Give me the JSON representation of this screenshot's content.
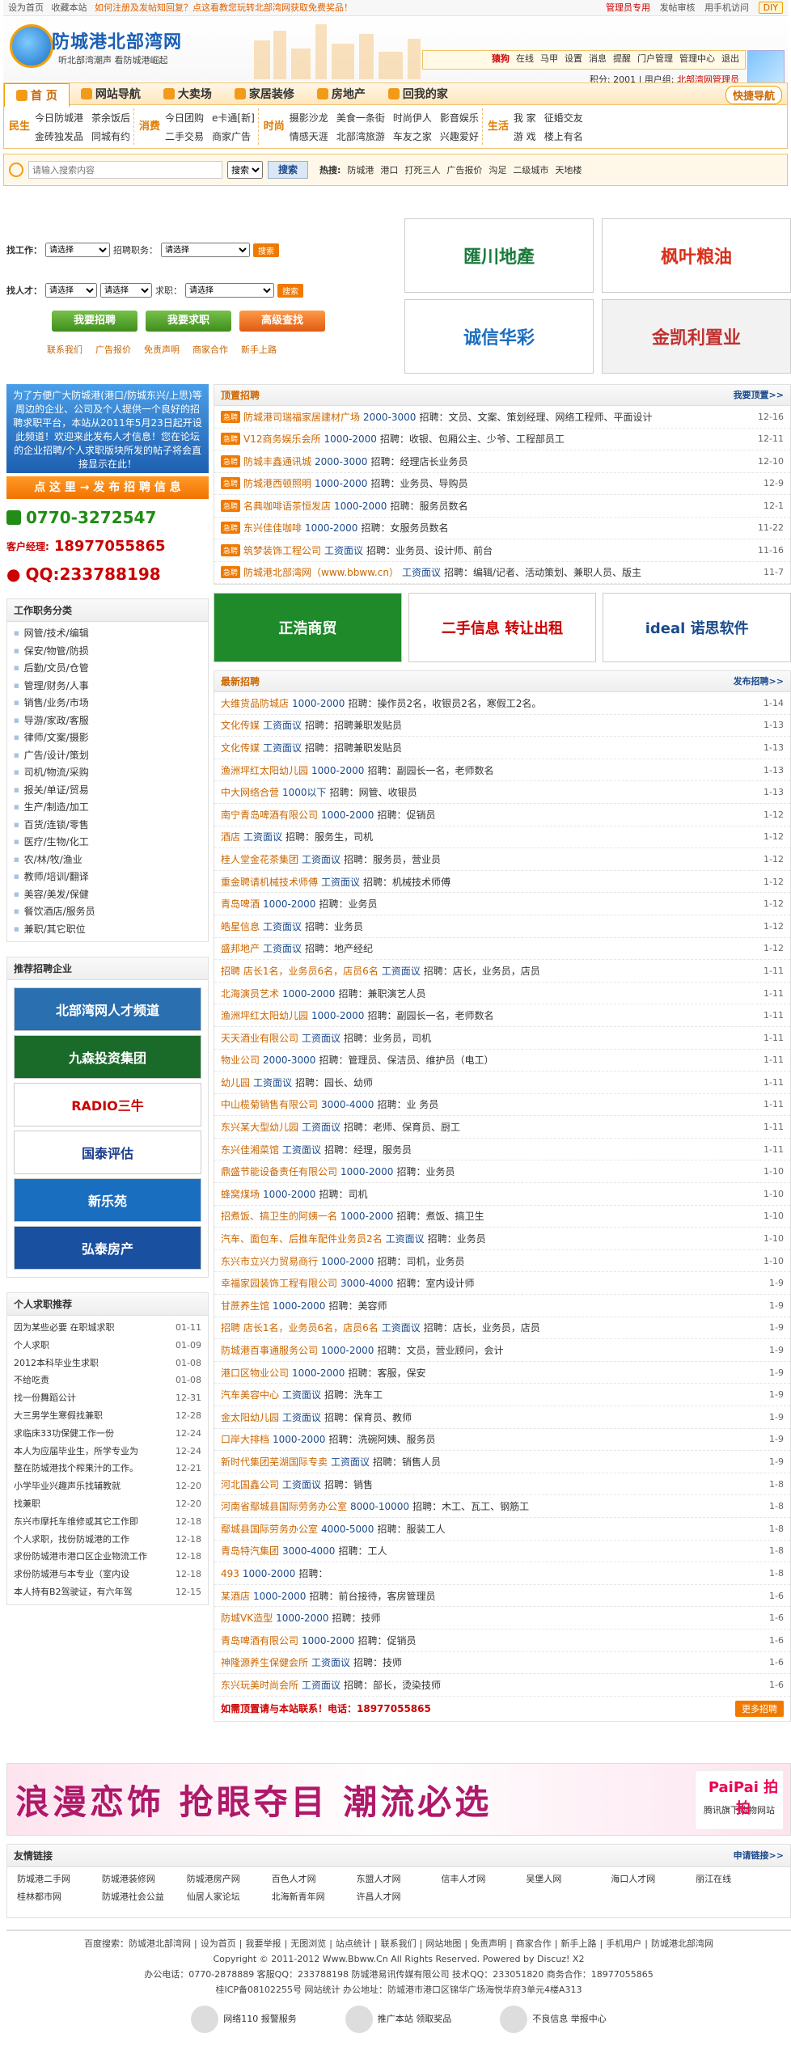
{
  "topbar": {
    "left": [
      "设为首页",
      "收藏本站"
    ],
    "notice": "如何注册及发帖知回复？点这看教您玩转北部湾网获取免费奖品！",
    "right": [
      "管理员专用",
      "发帖审核",
      "用手机访问"
    ],
    "diy": "DIY"
  },
  "logo": {
    "title": "防城港北部湾网",
    "slogan": "听北部湾潮声 看防城港崛起"
  },
  "user": {
    "name": "猿狗",
    "status": "在线",
    "items": [
      "马甲",
      "设置",
      "消息",
      "提醒",
      "门户管理",
      "管理中心",
      "退出"
    ],
    "points": "积分: 2001",
    "group_label": "用户组:",
    "group": "北部湾网管理员"
  },
  "nav": {
    "items": [
      "首 页",
      "网站导航",
      "大卖场",
      "家居装修",
      "房地产",
      "回我的家"
    ],
    "quick": "快捷导航"
  },
  "channels": [
    {
      "big": "民生",
      "links": [
        "今日防城港",
        "茶余饭后",
        "金砖独发品",
        "同城有约"
      ]
    },
    {
      "big": "消费",
      "links": [
        "今日团购",
        "e卡通[新]",
        "二手交易",
        "商家广告"
      ]
    },
    {
      "big": "时尚",
      "links": [
        "摄影沙龙",
        "美食一条街",
        "时尚伊人",
        "影音娱乐",
        "情感天涯",
        "北部湾旅游",
        "车友之家",
        "兴趣爱好"
      ]
    },
    {
      "big": "生活",
      "links": [
        "我 家",
        "征婚交友",
        "游 戏",
        "楼上有名"
      ]
    }
  ],
  "search": {
    "placeholder": "请输入搜索内容",
    "type": "搜索",
    "button": "搜索",
    "hot_label": "热搜:",
    "hot": [
      "防城港",
      "港口",
      "打死三人",
      "广告报价",
      "沟足",
      "二级城市",
      "天地楼"
    ]
  },
  "jobsearch": {
    "find_job": "找工作：",
    "pick": "请选择",
    "position": "招聘职务：",
    "go": "搜索",
    "find_talent": "找人才：",
    "seek": "求职：",
    "buttons": [
      "我要招聘",
      "我要求职",
      "高级查找"
    ],
    "links": [
      "联系我们",
      "广告报价",
      "免责声明",
      "商家合作",
      "新手上路"
    ]
  },
  "ads_tr": [
    "匯川地產",
    "枫叶粮油",
    "诚信华彩",
    "金凯利置业"
  ],
  "left": {
    "blue_ad": "为了方便广大防城港(港口/防城东兴/上思)等周边的企业、公司及个人提供一个良好的招聘求职平台，本站从2011年5月23日起开设此频道！欢迎来此发布人才信息！您在论坛的企业招聘/个人求职版块所发的帖子将会直接显示在此！",
    "post_btn": "点 这 里 → 发 布 招 聘 信 息",
    "phone": "0770-3272547",
    "mgr_label": "客户经理:",
    "mgr_phone": "18977055865",
    "qq": "QQ:233788198",
    "cat_title": "工作职务分类",
    "cats": [
      "网管/技术/编辑",
      "保安/物管/防损",
      "后勤/文员/仓管",
      "管理/财务/人事",
      "销售/业务/市场",
      "导游/家政/客服",
      "律师/文案/摄影",
      "广告/设计/策划",
      "司机/物流/采购",
      "报关/单证/贸易",
      "生产/制造/加工",
      "百货/连锁/零售",
      "医疗/生物/化工",
      "农/林/牧/渔业",
      "教师/培训/翻译",
      "美容/美发/保健",
      "餐饮酒店/服务员",
      "兼职/其它职位"
    ],
    "corp_title": "推荐招聘企业",
    "corps": [
      "北部湾网人才频道",
      "九森投资集团",
      "RADIO三牛",
      "国泰评估",
      "新乐苑",
      "弘泰房产"
    ],
    "pjob_title": "个人求职推荐",
    "pjobs": [
      [
        "因为某些必要 在职城求职",
        "01-11"
      ],
      [
        "个人求职",
        "01-09"
      ],
      [
        "2012本科毕业生求职",
        "01-08"
      ],
      [
        "不给吃责",
        "01-08"
      ],
      [
        "找一份舞蹈公计",
        "12-31"
      ],
      [
        "大三男学生寒假找兼职",
        "12-28"
      ],
      [
        "求临床33功保健工作一份",
        "12-24"
      ],
      [
        "本人为应届毕业生，所学专业为",
        "12-24"
      ],
      [
        "整在防城港找个榨果汁的工作。",
        "12-21"
      ],
      [
        "小学毕业兴趣声乐找辅教就",
        "12-20"
      ],
      [
        "找兼职",
        "12-20"
      ],
      [
        "东兴市摩托车维修或其它工作即",
        "12-18"
      ],
      [
        "个人求职，找份防城港的工作",
        "12-18"
      ],
      [
        "求份防城港市港口区企业物流工作",
        "12-18"
      ],
      [
        "求份防城港与本专业（室内设",
        "12-18"
      ],
      [
        "本人持有B2驾驶证，有六年驾",
        "12-15"
      ]
    ]
  },
  "top_jobs": {
    "title": "顶置招聘",
    "more": "我要顶置>>",
    "tag": "急聘",
    "rows": [
      [
        "防城港司瑞福家居建材广场",
        "2000-3000",
        "招聘：文员、文案、策划经理、网络工程师、平面设计",
        "12-16"
      ],
      [
        "V12商务娱乐会所",
        "1000-2000",
        "招聘：收银、包厢公主、少爷、工程部员工",
        "12-11"
      ],
      [
        "防城丰鑫通讯城",
        "2000-3000",
        "招聘：经理店长业务员",
        "12-10"
      ],
      [
        "防城港西顿照明",
        "1000-2000",
        "招聘：业务员、导购员",
        "12-9"
      ],
      [
        "名典咖啡语茶恒发店",
        "1000-2000",
        "招聘：服务员数名",
        "12-1"
      ],
      [
        "东兴佳佳咖啡",
        "1000-2000",
        "招聘：女服务员数名",
        "11-22"
      ],
      [
        "筑梦装饰工程公司",
        "工资面议",
        "招聘：业务员、设计师、前台",
        "11-16"
      ],
      [
        "防城港北部湾网（www.bbww.cn）",
        "工资面议",
        "招聘：编辑/记者、活动策划、兼职人员、版主",
        "11-7"
      ]
    ]
  },
  "mid_ads": [
    "正浩商贸",
    "二手信息 转让出租",
    "ideal 诺思软件"
  ],
  "latest": {
    "title": "最新招聘",
    "more": "发布招聘>>",
    "rows": [
      [
        "大维货品防城店",
        "1000-2000",
        "招聘：操作员2名，收银员2名，寒假工2名。",
        "1-14"
      ],
      [
        "文化传媒",
        "工资面议",
        "招聘：招聘兼职发贴员",
        "1-13"
      ],
      [
        "文化传媒",
        "工资面议",
        "招聘：招聘兼职发贴员",
        "1-13"
      ],
      [
        "渔洲坪红太阳幼儿园",
        "1000-2000",
        "招聘：副园长一名，老师数名",
        "1-13"
      ],
      [
        "中大网络合营",
        "1000以下",
        "招聘：网管、收银员",
        "1-13"
      ],
      [
        "南宁青岛啤酒有限公司",
        "1000-2000",
        "招聘：促销员",
        "1-12"
      ],
      [
        "酒店",
        "工资面议",
        "招聘：服务生，司机",
        "1-12"
      ],
      [
        "桂人堂金花茶集团",
        "工资面议",
        "招聘：服务员，营业员",
        "1-12"
      ],
      [
        "重金聘请机械技术师傅",
        "工资面议",
        "招聘：机械技术师傅",
        "1-12"
      ],
      [
        "青岛啤酒",
        "1000-2000",
        "招聘：业务员",
        "1-12"
      ],
      [
        "皓星信息",
        "工资面议",
        "招聘：业务员",
        "1-12"
      ],
      [
        "盛邦地产",
        "工资面议",
        "招聘：地产经纪",
        "1-12"
      ],
      [
        "招聘 店长1名，业务员6名，店员6名",
        "工资面议",
        "招聘：店长，业务员，店员",
        "1-11"
      ],
      [
        "北海演员艺术",
        "1000-2000",
        "招聘：兼职演艺人员",
        "1-11"
      ],
      [
        "渔洲坪红太阳幼儿园",
        "1000-2000",
        "招聘：副园长一名，老师数名",
        "1-11"
      ],
      [
        "天天酒业有限公司",
        "工资面议",
        "招聘：业务员，司机",
        "1-11"
      ],
      [
        "物业公司",
        "2000-3000",
        "招聘：管理员、保洁员、维护员（电工）",
        "1-11"
      ],
      [
        "幼儿园",
        "工资面议",
        "招聘：园长、幼师",
        "1-11"
      ],
      [
        "中山榄菊销售有限公司",
        "3000-4000",
        "招聘：业 务员",
        "1-11"
      ],
      [
        "东兴某大型幼儿园",
        "工资面议",
        "招聘：老师、保育员、厨工",
        "1-11"
      ],
      [
        "东兴佳湘菜馆",
        "工资面议",
        "招聘：经理，服务员",
        "1-11"
      ],
      [
        "鼎盛节能设备责任有限公司",
        "1000-2000",
        "招聘：业务员",
        "1-10"
      ],
      [
        "蜂窝煤场",
        "1000-2000",
        "招聘：司机",
        "1-10"
      ],
      [
        "招煮饭、搞卫生的阿姨一名",
        "1000-2000",
        "招聘：煮饭、搞卫生",
        "1-10"
      ],
      [
        "汽车、面包车、后推车配件业务员2名",
        "工资面议",
        "招聘：业务员",
        "1-10"
      ],
      [
        "东兴市立兴力贸易商行",
        "1000-2000",
        "招聘：司机，业务员",
        "1-10"
      ],
      [
        "幸福家园装饰工程有限公司",
        "3000-4000",
        "招聘：室内设计师",
        "1-9"
      ],
      [
        "甘蔗养生馆",
        "1000-2000",
        "招聘：美容师",
        "1-9"
      ],
      [
        "招聘 店长1名，业务员6名，店员6名",
        "工资面议",
        "招聘：店长，业务员，店员",
        "1-9"
      ],
      [
        "防城港百事通服务公司",
        "1000-2000",
        "招聘：文员，营业顾问，会计",
        "1-9"
      ],
      [
        "港口区物业公司",
        "1000-2000",
        "招聘：客服，保安",
        "1-9"
      ],
      [
        "汽车美容中心",
        "工资面议",
        "招聘：洗车工",
        "1-9"
      ],
      [
        "金太阳幼儿园",
        "工资面议",
        "招聘：保育员、教师",
        "1-9"
      ],
      [
        "口岸大排档",
        "1000-2000",
        "招聘：洗碗阿姨、服务员",
        "1-9"
      ],
      [
        "新时代集团芜湖国际专卖",
        "工资面议",
        "招聘：销售人员",
        "1-9"
      ],
      [
        "河北国鑫公司",
        "工资面议",
        "招聘：销售",
        "1-8"
      ],
      [
        "河南省鄢城县国际劳务办公室",
        "8000-10000",
        "招聘：木工、瓦工、钢筋工",
        "1-8"
      ],
      [
        "鄢城县国际劳务办公室",
        "4000-5000",
        "招聘：服装工人",
        "1-8"
      ],
      [
        "青岛特汽集团",
        "3000-4000",
        "招聘：工人",
        "1-8"
      ],
      [
        "493",
        "1000-2000",
        "招聘：",
        "1-8"
      ],
      [
        "某酒店",
        "1000-2000",
        "招聘：前台接待，客房管理员",
        "1-6"
      ],
      [
        "防城VK造型",
        "1000-2000",
        "招聘：技师",
        "1-6"
      ],
      [
        "青岛啤酒有限公司",
        "1000-2000",
        "招聘：促销员",
        "1-6"
      ],
      [
        "神隆源养生保健会所",
        "工资面议",
        "招聘：技师",
        "1-6"
      ],
      [
        "东兴玩美时尚会所",
        "工资面议",
        "招聘：部长，烫染技师",
        "1-6"
      ]
    ],
    "tel_note": "如需顶置请与本站联系！电话：18977055865",
    "more_btn": "更多招聘"
  },
  "banner": {
    "text": "浪漫恋饰 抢眼夺目 潮流必选",
    "pp": "腾讯旗下购物网站",
    "pp_logo": "PaiPai 拍拍"
  },
  "friends": {
    "title": "友情链接",
    "apply": "申请链接>>",
    "links": [
      "防城港二手网",
      "防城港装修网",
      "防城港房产网",
      "百色人才网",
      "东盟人才网",
      "信丰人才网",
      "吴堡人网",
      "海口人才网",
      "丽江在线",
      "桂林都市网",
      "防城港社会公益",
      "仙居人家论坛",
      "北海新青年网",
      "许昌人才网"
    ]
  },
  "footer": {
    "links": [
      "百度搜索：防城港北部湾网",
      "设为首页",
      "我要举报",
      "无图浏览",
      "站点统计",
      "联系我们",
      "网站地图",
      "免责声明",
      "商家合作",
      "新手上路",
      "手机用户",
      "防城港北部湾网"
    ],
    "copy": "Copyright © 2011-2012 Www.Bbww.Cn All Rights Reserved. Powered by Discuz! X2",
    "contact": "办公电话：0770-2878889  客服QQ：233788198  防城港易讯传媒有限公司  技术QQ：233051820  商务合作：18977055865",
    "icp": "桂ICP备08102255号  网站统计  办公地址：防城港市港口区锦华广场海悦华府3单元4楼A313",
    "badges": [
      "网络110 报警服务",
      "推广本站 领取奖品",
      "不良信息 举报中心"
    ]
  }
}
